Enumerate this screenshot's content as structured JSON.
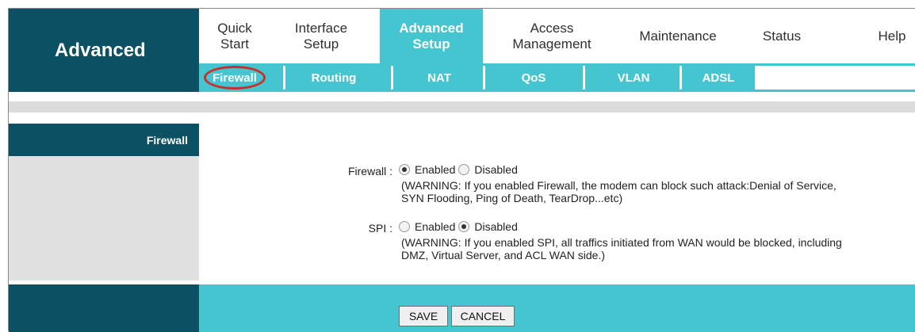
{
  "brand": "Advanced",
  "topnav": [
    {
      "line1": "Quick",
      "line2": "Start"
    },
    {
      "line1": "Interface",
      "line2": "Setup"
    },
    {
      "line1": "Advanced",
      "line2": "Setup",
      "active": true
    },
    {
      "line1": "Access",
      "line2": "Management"
    },
    {
      "line1": "Maintenance",
      "line2": ""
    },
    {
      "line1": "Status",
      "line2": ""
    },
    {
      "line1": "Help",
      "line2": ""
    }
  ],
  "subnav": [
    "Firewall",
    "Routing",
    "NAT",
    "QoS",
    "VLAN",
    "ADSL"
  ],
  "section": {
    "title": "Firewall"
  },
  "firewall": {
    "label": "Firewall :",
    "enabled_label": "Enabled",
    "disabled_label": "Disabled",
    "selected": "Enabled",
    "warning_line1": "(WARNING: If you enabled Firewall, the modem can block such attack:Denial of Service,",
    "warning_line2": "SYN Flooding, Ping of Death, TearDrop...etc)"
  },
  "spi": {
    "label": "SPI :",
    "enabled_label": "Enabled",
    "disabled_label": "Disabled",
    "selected": "Disabled",
    "warning_line1": "(WARNING: If you enabled SPI, all traffics initiated from WAN would be blocked, including",
    "warning_line2": "DMZ, Virtual Server, and ACL WAN side.)"
  },
  "buttons": {
    "save": "SAVE",
    "cancel": "CANCEL"
  },
  "colors": {
    "dark": "#0c5064",
    "accent": "#45c5d0",
    "highlight_circle": "#c9302c"
  }
}
